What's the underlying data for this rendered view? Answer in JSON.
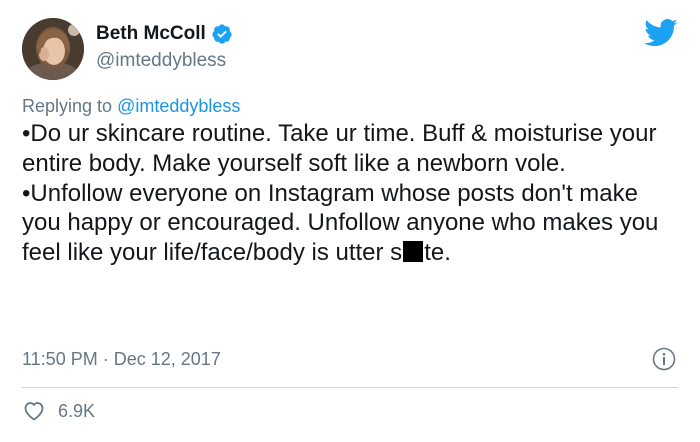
{
  "author": {
    "name": "Beth McColl",
    "handle": "@imteddybless",
    "verified": true,
    "verified_icon": "verified-badge-icon"
  },
  "brand": {
    "icon": "twitter-bird-icon",
    "color": "#1da1f2"
  },
  "reply": {
    "prefix": "Replying to",
    "handle": "@imteddybless"
  },
  "body": {
    "para1": "•Do ur skincare routine. Take ur time. Buff & moisturise your entire body. Make yourself soft like a newborn vole.",
    "para2_before": "•Unfollow everyone on Instagram whose posts don't make you happy or encouraged. Unfollow anyone who makes you feel like your life/face/body is utter s",
    "para2_after": "te."
  },
  "meta": {
    "time": "11:50 PM",
    "separator": "·",
    "date": "Dec 12, 2017",
    "info_icon": "info-icon"
  },
  "likes": {
    "icon": "heart-icon",
    "count": "6.9K"
  },
  "colors": {
    "text": "#14171a",
    "secondary": "#657786",
    "link": "#1b95e0",
    "divider": "#ccd6dd"
  }
}
